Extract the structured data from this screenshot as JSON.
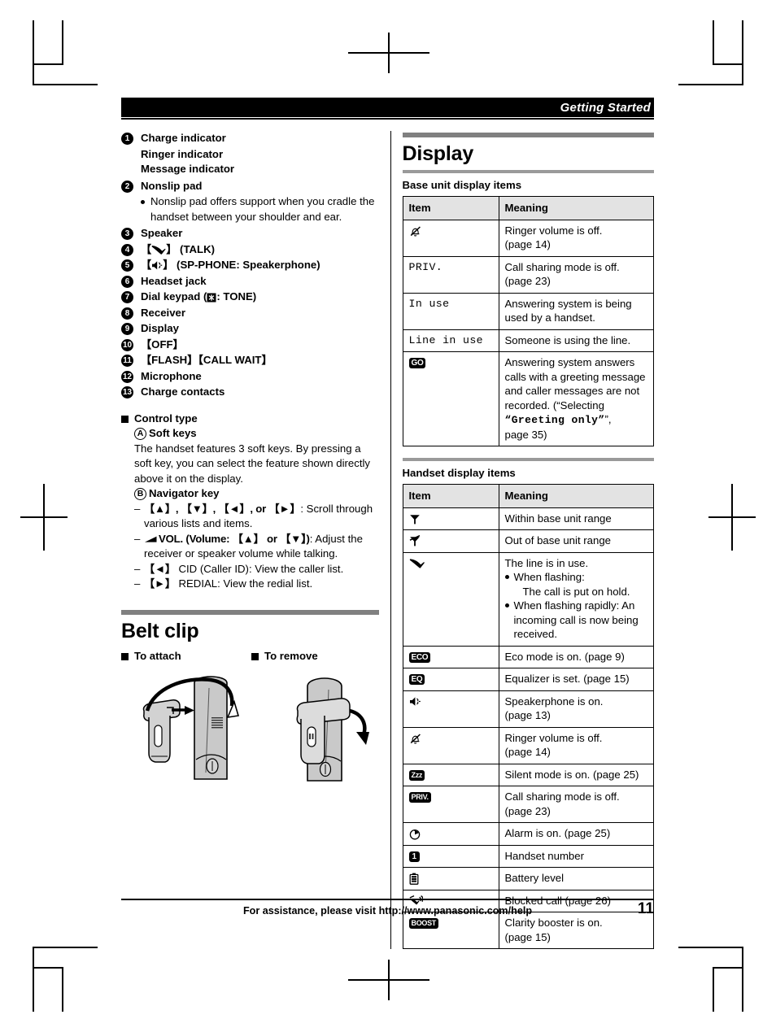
{
  "page": {
    "running_head": "Getting Started",
    "number": "11",
    "footer_text": "For assistance, please visit http://www.panasonic.com/help"
  },
  "left_column": {
    "parts_list": [
      {
        "num": "1",
        "label": "Charge indicator",
        "extra_lines": [
          "Ringer indicator",
          "Message indicator"
        ]
      },
      {
        "num": "2",
        "label": "Nonslip pad",
        "bullet": "Nonslip pad offers support when you cradle the handset between your shoulder and ear."
      },
      {
        "num": "3",
        "label": "Speaker"
      },
      {
        "num": "4",
        "label": "[✐] (TALK)",
        "icon": "phone-handset-icon",
        "label_plain": "(TALK)"
      },
      {
        "num": "5",
        "label": "[⌘] (SP-PHONE: Speakerphone)",
        "icon": "speakerphone-icon",
        "label_plain": "(SP-PHONE: Speakerphone)"
      },
      {
        "num": "6",
        "label": "Headset jack"
      },
      {
        "num": "7",
        "label": "Dial keypad (✱: TONE)",
        "label_plain": "Dial keypad (",
        "label_tail": ": TONE)",
        "icon": "asterisk-key-icon"
      },
      {
        "num": "8",
        "label": "Receiver"
      },
      {
        "num": "9",
        "label": "Display"
      },
      {
        "num": "10",
        "label": "【OFF】"
      },
      {
        "num": "11",
        "label": "【FLASH】【CALL WAIT】"
      },
      {
        "num": "12",
        "label": "Microphone"
      },
      {
        "num": "13",
        "label": "Charge contacts"
      }
    ],
    "control_type": {
      "heading": "Control type",
      "soft_keys": {
        "marker": "A",
        "title": "Soft keys",
        "body": "The handset features 3 soft keys. By pressing a soft key, you can select the feature shown directly above it on the display."
      },
      "navigator_key": {
        "marker": "B",
        "title": "Navigator key",
        "items": [
          {
            "keys": "【▲】, 【▼】, 【◄】, or 【►】",
            "text": ": Scroll through various lists and items."
          },
          {
            "keys": "VOL. (Volume: 【▲】 or 【▼】)",
            "text": ": Adjust the receiver or speaker volume while talking.",
            "icon": "volume-wedge-icon"
          },
          {
            "keys": "【◄】",
            "text": " CID (Caller ID): View the caller list."
          },
          {
            "keys": "【►】",
            "text": " REDIAL: View the redial list."
          }
        ]
      }
    },
    "belt_clip": {
      "title": "Belt clip",
      "attach_label": "To attach",
      "remove_label": "To remove"
    }
  },
  "right_column": {
    "section_title": "Display",
    "base_unit": {
      "subtitle": "Base unit display items",
      "headers": [
        "Item",
        "Meaning"
      ],
      "rows": [
        {
          "item_icon": "ringer-off-icon",
          "item_text": "",
          "meaning": "Ringer volume is off.\n(page 14)"
        },
        {
          "item_text": "PRIV.",
          "item_mono": true,
          "meaning": "Call sharing mode is off.\n(page 23)"
        },
        {
          "item_text": "In use",
          "item_mono": true,
          "meaning": "Answering system is being used by a handset."
        },
        {
          "item_text": "Line in use",
          "item_mono": true,
          "meaning": "Someone is using the line."
        },
        {
          "item_badge": "GO",
          "item_icon": "greeting-only-badge-icon",
          "meaning_rich": true,
          "meaning_pre": "Answering system answers calls with a greeting message and caller messages are not recorded. (“Selecting ",
          "meaning_mono": "“Greeting only”",
          "meaning_post": "”,",
          "meaning_tail": "page 35)"
        }
      ]
    },
    "handset": {
      "subtitle": "Handset display items",
      "headers": [
        "Item",
        "Meaning"
      ],
      "rows": [
        {
          "item_icon": "antenna-in-range-icon",
          "meaning": "Within base unit range"
        },
        {
          "item_icon": "antenna-out-of-range-icon",
          "meaning": "Out of base unit range"
        },
        {
          "item_icon": "phone-handset-icon",
          "meaning_lines": [
            "The line is in use."
          ],
          "bullets": [
            "When flashing:\n   The call is put on hold.",
            "When flashing rapidly: An incoming call is now being received."
          ]
        },
        {
          "item_badge": "ECO",
          "item_icon": "eco-badge-icon",
          "meaning": "Eco mode is on. (page 9)"
        },
        {
          "item_badge": "EQ",
          "item_icon": "eq-badge-icon",
          "meaning": "Equalizer is set. (page 15)"
        },
        {
          "item_icon": "speakerphone-icon",
          "meaning": "Speakerphone is on.\n(page 13)"
        },
        {
          "item_icon": "ringer-off-icon",
          "meaning": "Ringer volume is off.\n(page 14)"
        },
        {
          "item_badge": "Zzz",
          "item_icon": "silent-mode-badge-icon",
          "meaning": "Silent mode is on. (page 25)"
        },
        {
          "item_badge": "PRIV.",
          "item_icon": "priv-badge-icon",
          "meaning": "Call sharing mode is off.\n(page 23)"
        },
        {
          "item_icon": "alarm-clock-icon",
          "meaning": "Alarm is on. (page 25)"
        },
        {
          "item_badge": "1",
          "item_icon": "handset-number-badge-icon",
          "meaning": "Handset number"
        },
        {
          "item_icon": "battery-icon",
          "meaning": "Battery level"
        },
        {
          "item_icon": "blocked-call-icon",
          "meaning": "Blocked call (page 26)"
        },
        {
          "item_badge": "BOOST",
          "item_icon": "boost-badge-icon",
          "meaning": "Clarity booster is on.\n(page 15)"
        }
      ]
    }
  },
  "colors": {
    "header_bar": "#000000",
    "section_rule": "#808080",
    "table_header_bg": "#e3e3e3",
    "figure_fill": "#c8c8c8"
  }
}
